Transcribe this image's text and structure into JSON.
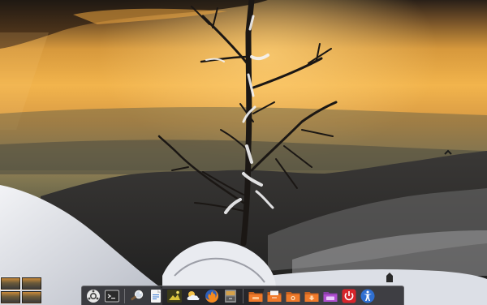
{
  "wallpaper": {
    "subject": "snow-covered-bare-tree-at-sunset",
    "colors": {
      "sky_top": "#3a2a1e",
      "sky_glow": "#f0b24a",
      "haze": "#8a7a52",
      "mountains": "#2a2a2a",
      "snow": "#e6e8ee"
    }
  },
  "workspace_switcher": {
    "workspaces": [
      {
        "name": "workspace-1",
        "active": true
      },
      {
        "name": "workspace-2",
        "active": false
      },
      {
        "name": "workspace-3",
        "active": false
      },
      {
        "name": "workspace-4",
        "active": false
      }
    ]
  },
  "dock": {
    "background": "#28282c",
    "items": [
      {
        "name": "menu-launcher-icon"
      },
      {
        "name": "terminal-icon"
      },
      {
        "separator": true
      },
      {
        "name": "search-tool-icon"
      },
      {
        "name": "text-editor-icon"
      },
      {
        "name": "image-viewer-icon"
      },
      {
        "name": "weather-icon"
      },
      {
        "name": "firefox-icon"
      },
      {
        "name": "file-manager-icon"
      },
      {
        "separator": true
      },
      {
        "name": "folder-orange-icon"
      },
      {
        "name": "folder-documents-icon"
      },
      {
        "name": "folder-pictures-icon"
      },
      {
        "name": "folder-downloads-icon"
      },
      {
        "name": "folder-video-icon"
      },
      {
        "name": "power-icon"
      },
      {
        "name": "accessibility-icon"
      }
    ]
  }
}
